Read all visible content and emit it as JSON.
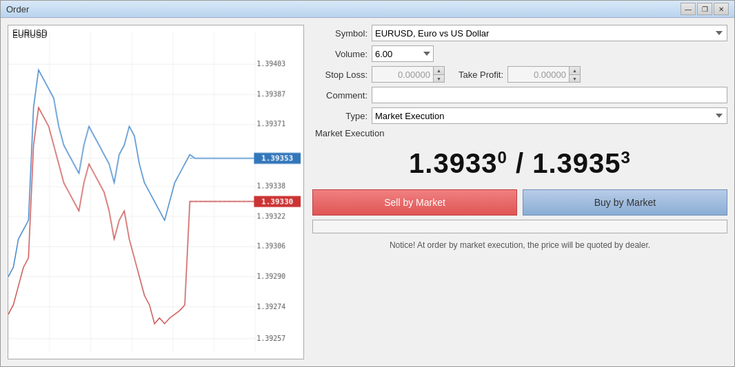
{
  "window": {
    "title": "Order",
    "buttons": {
      "minimize": "—",
      "restore": "❐",
      "close": "✕"
    }
  },
  "form": {
    "symbol_label": "Symbol:",
    "symbol_value": "EURUSD, Euro vs US Dollar",
    "volume_label": "Volume:",
    "volume_value": "6.00",
    "stoploss_label": "Stop Loss:",
    "stoploss_value": "0.00000",
    "takeprofit_label": "Take Profit:",
    "takeprofit_value": "0.00000",
    "comment_label": "Comment:",
    "comment_value": "",
    "type_label": "Type:",
    "type_value": "Market Execution"
  },
  "execution": {
    "section_label": "Market Execution",
    "bid_price": "1.39330",
    "ask_price": "1.39353",
    "bid_main": "1.3933",
    "bid_super": "0",
    "ask_main": "1.3935",
    "ask_super": "3",
    "separator": " / ",
    "sell_label": "Sell by Market",
    "buy_label": "Buy by Market",
    "notice": "Notice! At order by market execution, the price will be quoted by dealer."
  },
  "chart": {
    "symbol": "EURUSD",
    "price_levels": [
      "1.39403",
      "1.39387",
      "1.39371",
      "1.39353",
      "1.39338",
      "1.39322",
      "1.39306",
      "1.39290",
      "1.39274",
      "1.39257"
    ],
    "ask_label": "1.39353",
    "bid_label": "1.39330"
  }
}
